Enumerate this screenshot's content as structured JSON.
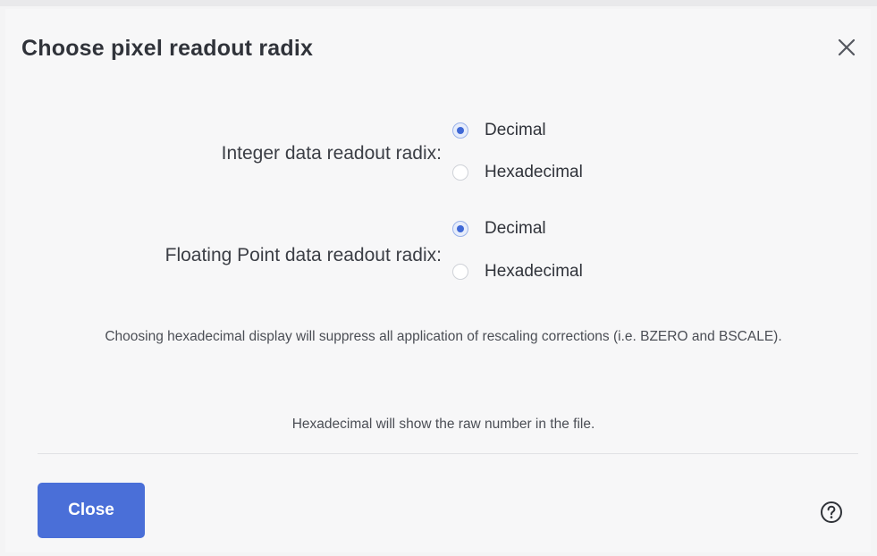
{
  "dialog": {
    "title": "Choose pixel readout radix",
    "close_icon": "close-icon",
    "help_icon": "help-circle-icon"
  },
  "integer_radix": {
    "label": "Integer data readout radix:",
    "options": [
      {
        "label": "Decimal",
        "selected": true
      },
      {
        "label": "Hexadecimal",
        "selected": false
      }
    ]
  },
  "float_radix": {
    "label": "Floating Point data readout radix:",
    "options": [
      {
        "label": "Decimal",
        "selected": true
      },
      {
        "label": "Hexadecimal",
        "selected": false
      }
    ]
  },
  "notes": {
    "rescaling": "Choosing hexadecimal display will suppress all application of rescaling corrections (i.e. BZERO and BSCALE).",
    "raw": "Hexadecimal will show the raw number in the file."
  },
  "footer": {
    "close_label": "Close"
  },
  "colors": {
    "accent": "#4a6fd8",
    "background": "#f7f7f8"
  }
}
